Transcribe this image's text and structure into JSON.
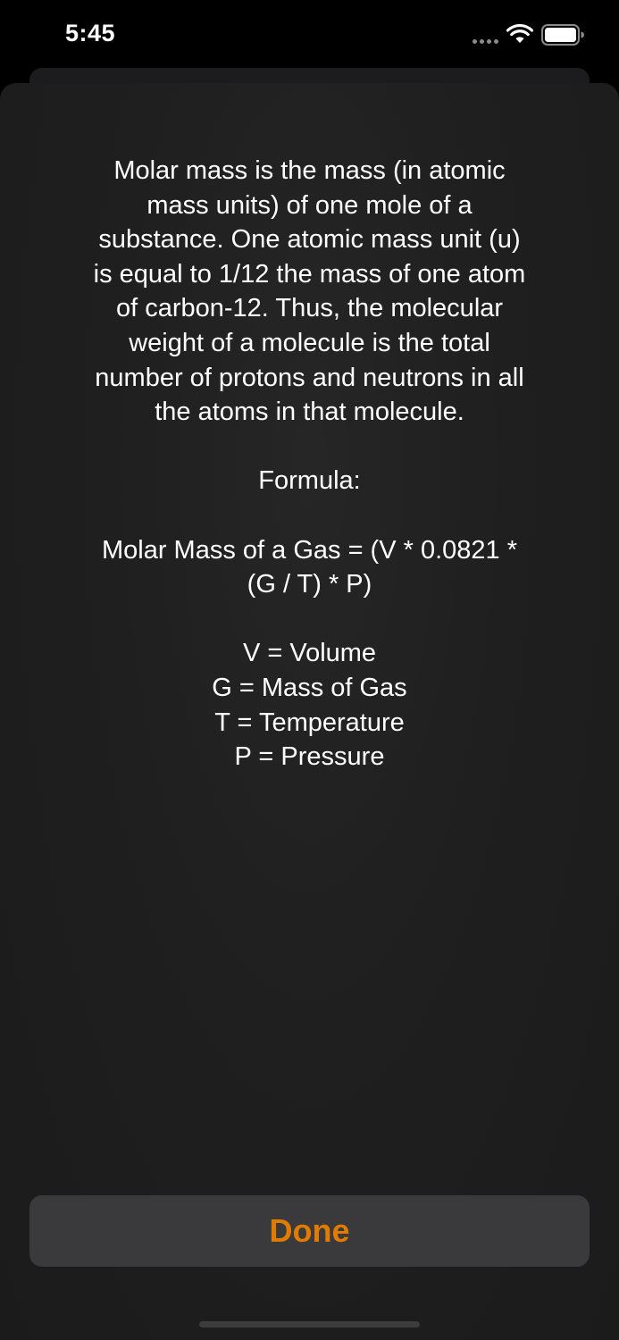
{
  "status_bar": {
    "time": "5:45",
    "icons": [
      "signal-dots-icon",
      "wifi-icon",
      "battery-icon"
    ]
  },
  "content": {
    "info_text": "Molar mass is the mass (in atomic\nmass units) of one mole of a\nsubstance. One atomic mass unit (u)\nis equal to 1/12 the mass of one atom\nof carbon-12. Thus, the molecular\nweight of a molecule is the total\nnumber of protons and neutrons in all\nthe atoms in that molecule.\n\nFormula:\n\nMolar Mass of a Gas = (V * 0.0821 *\n(G / T) * P)\n\nV = Volume\nG = Mass of Gas\nT = Temperature\nP = Pressure"
  },
  "actions": {
    "done_label": "Done"
  },
  "colors": {
    "accent": "#e07b00",
    "sheet_background": "#1f1f1f",
    "button_background": "#3a3a3c",
    "text": "#ffffff"
  }
}
